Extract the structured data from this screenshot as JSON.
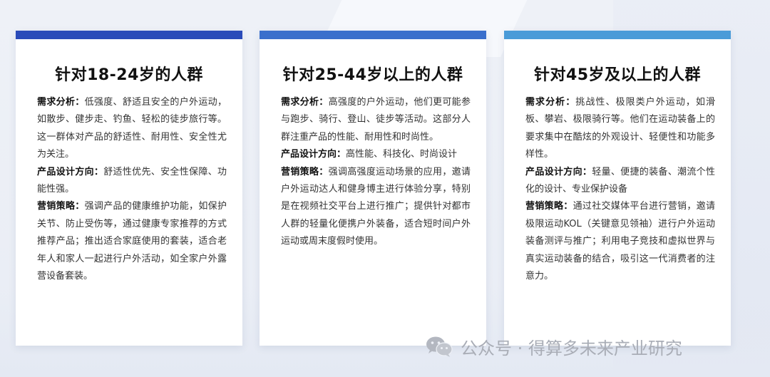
{
  "colors": {
    "card1_bar": "#2a4bb9",
    "card2_bar": "#3a6fcc",
    "card3_bar": "#4a9bd8"
  },
  "cards": [
    {
      "title": "针对18-24岁的人群",
      "demand_label": "需求分析：",
      "demand_text": "低强度、舒适且安全的户外运动，如散步、健步走、钓鱼、轻松的徒步旅行等。这一群体对产品的舒适性、耐用性、安全性尤为关注。",
      "design_label": "产品设计方向：",
      "design_text": "舒适性优先、安全性保障、功能性强。",
      "marketing_label": "营销策略：",
      "marketing_text": "强调产品的健康维护功能，如保护关节、防止受伤等，通过健康专家推荐的方式推荐产品；推出适合家庭使用的套装，适合老年人和家人一起进行户外活动，如全家户外露营设备套装。"
    },
    {
      "title": "针对25-44岁以上的人群",
      "demand_label": "需求分析：",
      "demand_text": "高强度的户外运动，他们更可能参与跑步、骑行、登山、徒步等活动。这部分人群注重产品的性能、耐用性和时尚性。",
      "design_label": "产品设计方向：",
      "design_text": "高性能、科技化、时尚设计",
      "marketing_label": "营销策略：",
      "marketing_text": "强调高强度运动场景的应用，邀请户外运动达人和健身博主进行体验分享，特别是在视频社交平台上进行推广；提供针对都市人群的轻量化便携户外装备，适合短时间户外运动或周末度假时使用。"
    },
    {
      "title": "针对45岁及以上的人群",
      "demand_label": "需求分析：",
      "demand_text": "挑战性、极限类户外运动，如滑板、攀岩、极限骑行等。他们在运动装备上的要求集中在酷炫的外观设计、轻便性和功能多样性。",
      "design_label": "产品设计方向：",
      "design_text": "轻量、便捷的装备、潮流个性化的设计、专业保护设备",
      "marketing_label": "营销策略：",
      "marketing_text": "通过社交媒体平台进行营销，邀请极限运动KOL（关键意见领袖）进行户外运动装备测评与推广；利用电子竞技和虚拟世界与真实运动装备的结合，吸引这一代消费者的注意力。"
    }
  ],
  "watermark": {
    "icon": "wechat-icon",
    "text": "公众号 · 得算多未来产业研究"
  }
}
